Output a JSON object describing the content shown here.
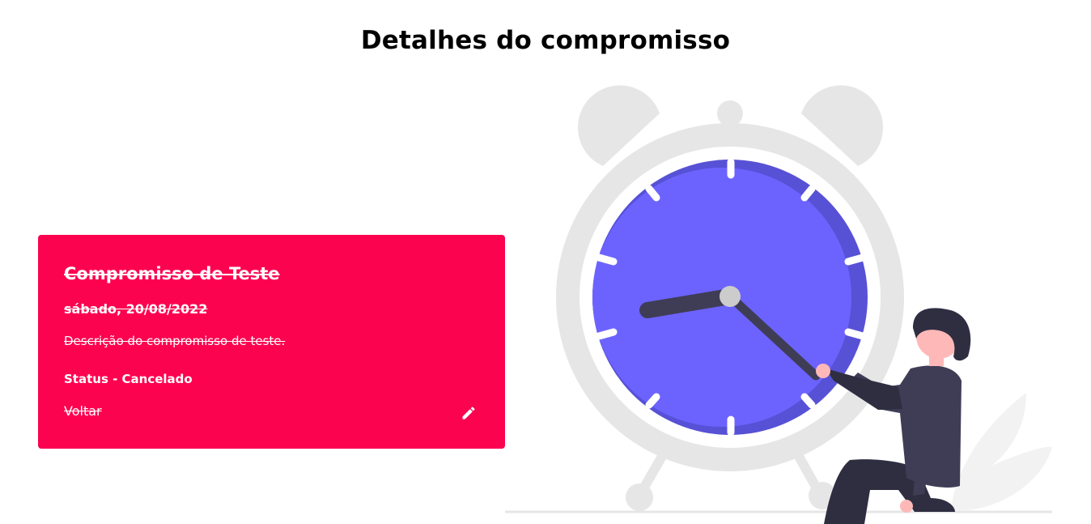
{
  "page": {
    "title": "Detalhes do compromisso"
  },
  "appointment": {
    "title": "Compromisso de Teste",
    "date": "sábado, 20/08/2022",
    "description": "Descrição do compromisso de teste.",
    "status": "Status - Cancelado",
    "back_label": "Voltar",
    "edit_icon": "pencil-icon"
  },
  "colors": {
    "card_background": "#fc0350",
    "clock_face": "#6c63ff",
    "clock_face_shadow": "#5751d6",
    "clock_frame": "#e6e6e6",
    "hands": "#3f3d56",
    "skin": "#ffb8b8"
  },
  "illustration": {
    "name": "woman-pulling-clock-hand-illustration"
  }
}
